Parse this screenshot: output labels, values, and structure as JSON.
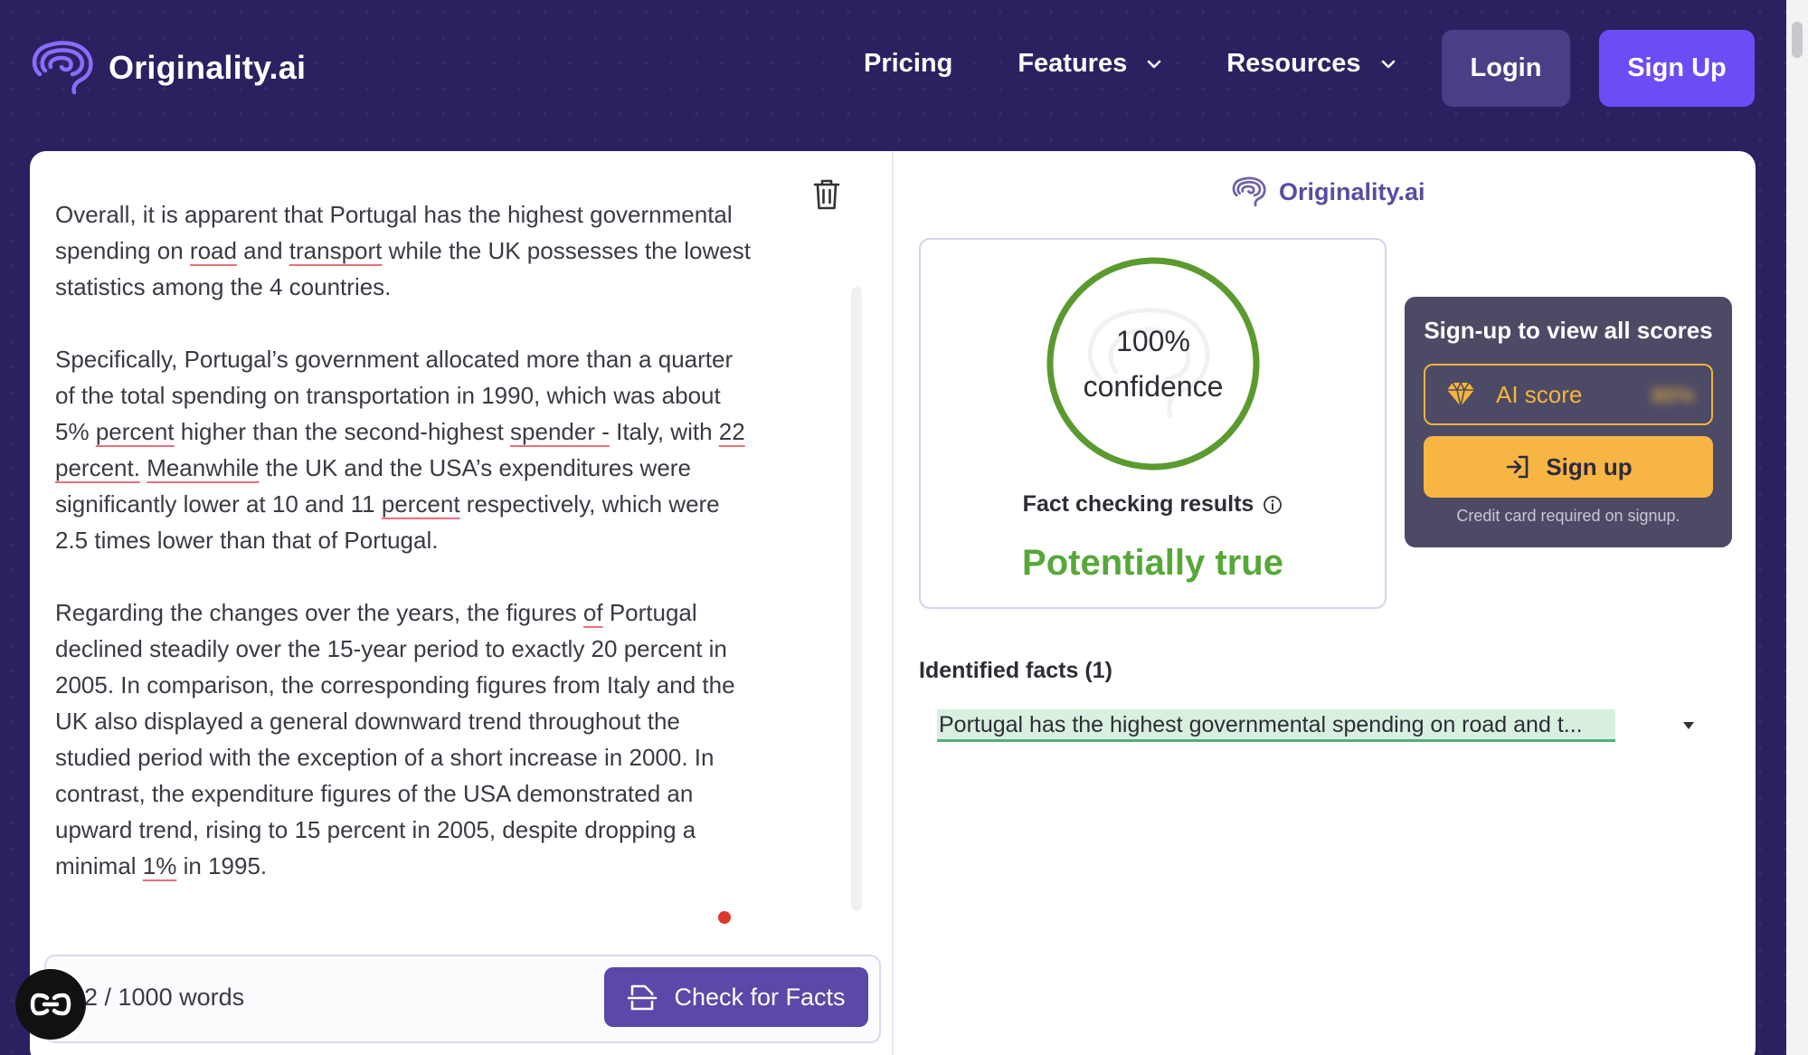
{
  "nav": {
    "brand": "Originality.ai",
    "links": [
      {
        "label": "Pricing",
        "has_dropdown": false
      },
      {
        "label": "Features",
        "has_dropdown": true
      },
      {
        "label": "Resources",
        "has_dropdown": true
      }
    ],
    "login_label": "Login",
    "signup_label": "Sign Up"
  },
  "editor": {
    "paragraphs": [
      [
        "Overall, it is apparent that Portugal has the highest governmental spending on ",
        {
          "u": "road"
        },
        " and ",
        {
          "u": "transport"
        },
        " while the UK possesses the lowest statistics among the 4 countries."
      ],
      [
        "Specifically, Portugal’s government allocated more than a quarter of the total spending on transportation in 1990, which was about 5% ",
        {
          "u": "percent"
        },
        " higher than the second-highest ",
        {
          "u": "spender -"
        },
        " Italy, with ",
        {
          "u": "22 percent."
        },
        " ",
        {
          "u": "Meanwhile"
        },
        " the UK and the USA’s expenditures were significantly lower at 10 and 11 ",
        {
          "u": "percent"
        },
        " respectively, which were 2.5 times lower than that of Portugal."
      ],
      [
        "Regarding the changes over the years, the figures ",
        {
          "u": "of"
        },
        " Portugal declined steadily over the 15-year period to exactly 20 percent in 2005. In comparison, the corresponding figures from Italy and the UK also displayed a general downward trend throughout the studied period with the exception of a short increase in 2000. In contrast, the expenditure figures of the USA demonstrated an upward trend, rising to 15 percent in 2005, despite dropping a minimal ",
        {
          "u": "1%"
        },
        " in 1995."
      ]
    ],
    "word_count": "2 / 1000 words",
    "check_button": "Check for Facts"
  },
  "result": {
    "brand": "Originality.ai",
    "confidence_value": "100%",
    "confidence_label": "confidence",
    "confidence_fraction": 1.0,
    "fact_checking_label": "Fact checking results",
    "verdict": "Potentially true",
    "verdict_color": "#56a839",
    "ring_color": "#5a9a2f"
  },
  "signup_panel": {
    "title": "Sign-up to view all scores",
    "ai_score_label": "AI score",
    "ai_score_blurred": "80%",
    "signup_label": "Sign up",
    "note": "Credit card required on signup."
  },
  "facts": {
    "title": "Identified facts (1)",
    "items": [
      "Portugal has the highest governmental spending on road and t..."
    ]
  },
  "colors": {
    "nav_bg": "#2b2160",
    "primary": "#6c4cf5",
    "accent_orange": "#f7b544"
  }
}
